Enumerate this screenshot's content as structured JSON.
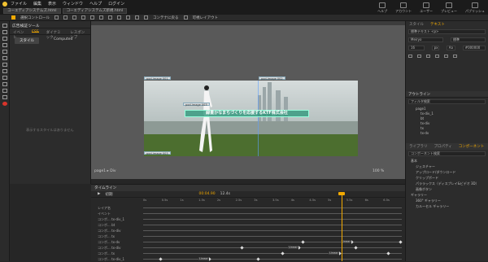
{
  "menu": {
    "items": [
      "ファイル",
      "編集",
      "表示",
      "ウィンドウ",
      "ヘルプ",
      "ログイン"
    ],
    "right": [
      "ヘルプ",
      "アカウント",
      "ユーザー",
      "プレビュー",
      "パブリッシュ"
    ]
  },
  "doc_tabs": [
    "コーエディアシステムズ.html",
    "コーエディアシステムズ新規.html"
  ],
  "toolbar": {
    "snap_label": "選択コントロール",
    "content_label": "コンテナに戻る",
    "layout_label": "可視レイアウト"
  },
  "left_panel": {
    "title": "広告検証ツール",
    "tabs": [
      "イベント",
      "CSS",
      "ダイナミック",
      "レスポンシブ"
    ],
    "active_tab": "CSS",
    "sub_tabs": [
      "スタイル",
      "Computed"
    ],
    "hint": "表示するスタイルはありません"
  },
  "canvas": {
    "banner_text": "緑豊かなまちづくりを応援するKTF株式会社",
    "tags": [
      "pod-image 001",
      "pod-image 002",
      "pod-image 003",
      "pod-image 003"
    ],
    "page_label": "page1 ▸ Div",
    "zoom": "100 %"
  },
  "right_panel": {
    "tabs": [
      "スタイル",
      "テキスト"
    ],
    "font_name": "標準テキスト <p>",
    "font_family": "Meiryo",
    "font_weight": "標準",
    "font_size": "16",
    "font_unit": "px",
    "line_height": "Aa",
    "color": "#000000",
    "outline_title": "アウトライン",
    "outline_search": "フィルタ検索",
    "outline_items": [
      "page1",
      "tx-div_1",
      "bt",
      "tx-div",
      "tx",
      "tx-dv"
    ],
    "lib_tabs": [
      "ライブラリ",
      "プロパティ",
      "コンポーネント"
    ],
    "comp_search": "コンポーネント検索",
    "comp_items": [
      "基本",
      "ジェスチャー",
      "アップロード/ダウンロード",
      "クリップボード",
      "パララックス（ディスプレイ&ビデオ 3D）",
      "画像ボタン",
      "ギャラリー",
      "360° ギャラリー",
      "カルーセル ギャラリー"
    ]
  },
  "timeline": {
    "title": "タイムライン",
    "label": "初期",
    "time": "00:04.90",
    "duration": "12.4s",
    "ticks": [
      "0s",
      "0.5s",
      "1s",
      "1.5s",
      "2s",
      "2.5s",
      "3s",
      "3.5s",
      "4s",
      "4.5s",
      "5s",
      "5.5s",
      "6s",
      "6.5s"
    ],
    "rows": [
      "レイア名",
      "イベント",
      "コンポ... tx-div_1",
      "コンポ... bt",
      "コンポ... tx-div",
      "コンポ... tx",
      "コンポ... tx-dv",
      "コンポ... tx-div",
      "コンポ... tx",
      "コンポ... tx-div_1"
    ],
    "linear_label": "Linear"
  },
  "colors": {
    "accent": "#f2a900",
    "banner": "#2a9878"
  }
}
